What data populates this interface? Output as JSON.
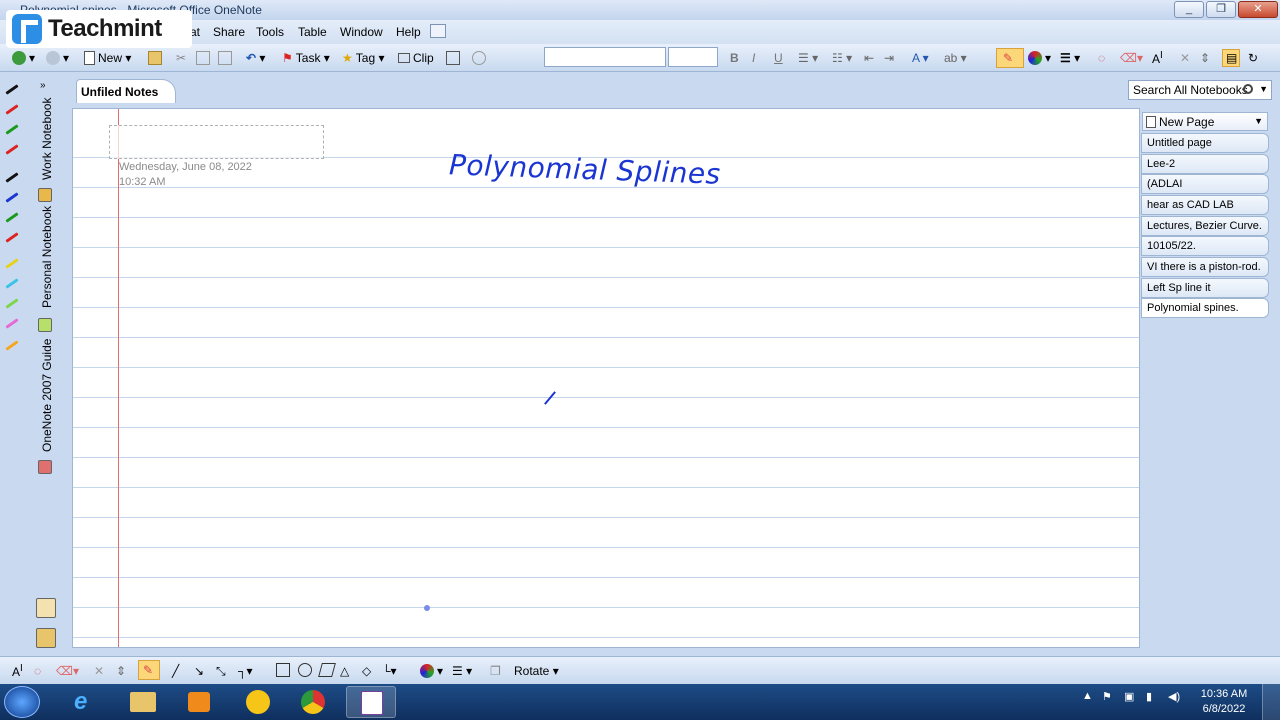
{
  "window": {
    "title": "Polynomial spines - Microsoft Office OneNote",
    "controls": [
      "minimize",
      "restore",
      "close"
    ]
  },
  "logo": {
    "text": "Teachmint"
  },
  "menubar": {
    "items": [
      "at",
      "Share",
      "Tools",
      "Table",
      "Window",
      "Help"
    ]
  },
  "toolbar": {
    "new_label": "New",
    "task_label": "Task",
    "tag_label": "Tag",
    "clip_label": "Clip",
    "font_name": "",
    "font_size": ""
  },
  "notebooks": [
    "Work Notebook",
    "Personal Notebook",
    "OneNote 2007 Guide"
  ],
  "section_tab": "Unfiled Notes",
  "search": {
    "placeholder": "Search All Notebooks"
  },
  "page": {
    "date": "Wednesday, June 08, 2022",
    "time": "10:32 AM",
    "ink_title": "Polynomial Splines"
  },
  "page_list": {
    "new_page": "New Page",
    "items": [
      "Untitled page",
      "Lee-2",
      "(ADLAI",
      "hear as CAD LAB",
      "Lectures, Bezier Curve.",
      "10105/22.",
      "VI there is a piston-rod.",
      "Left Sp line it",
      "Polynomial spines."
    ],
    "active_index": 8
  },
  "drawbar": {
    "rotate_label": "Rotate"
  },
  "taskbar": {
    "time": "10:36 AM",
    "date": "6/8/2022"
  },
  "colors": {
    "ink": "#1a35d1",
    "margin": "#e36b6b",
    "rule": "#c4d6ec"
  }
}
